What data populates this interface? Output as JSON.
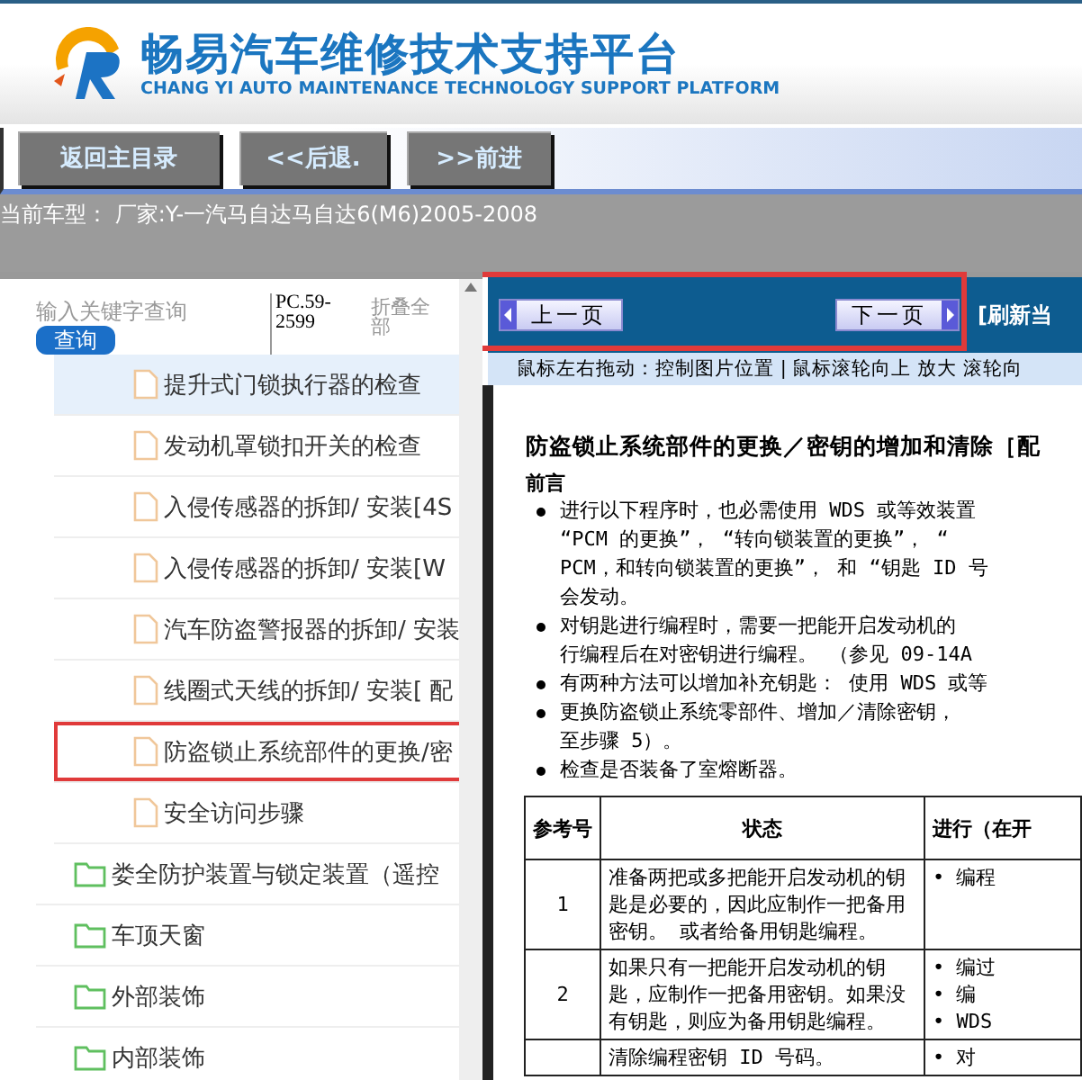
{
  "header": {
    "title": "畅易汽车维修技术支持平台",
    "subtitle": "CHANG YI AUTO MAINTENANCE TECHNOLOGY SUPPORT PLATFORM"
  },
  "nav_buttons": [
    "返回主目录",
    "<<后退.",
    ">>前进"
  ],
  "current_model": "当前车型： 厂家:Y-一汽马自达马自达6(M6)2005-2008",
  "sidebar": {
    "search": {
      "placeholder": "输入关键字查询",
      "button": "查询"
    },
    "code": "PC.59-2599",
    "collapse": "折叠全部",
    "tree_items": [
      {
        "label": "提升式门锁执行器的检查",
        "kind": "file",
        "selected": true,
        "highlighted": false
      },
      {
        "label": "发动机罩锁扣开关的检查",
        "kind": "file",
        "selected": false,
        "highlighted": false
      },
      {
        "label": "入侵传感器的拆卸/ 安装[4S",
        "kind": "file",
        "selected": false,
        "highlighted": false
      },
      {
        "label": "入侵传感器的拆卸/ 安装[W",
        "kind": "file",
        "selected": false,
        "highlighted": false
      },
      {
        "label": "汽车防盗警报器的拆卸/ 安装",
        "kind": "file",
        "selected": false,
        "highlighted": false
      },
      {
        "label": "线圈式天线的拆卸/ 安装[ 配",
        "kind": "file",
        "selected": false,
        "highlighted": false
      },
      {
        "label": "防盗锁止系统部件的更换/密",
        "kind": "file",
        "selected": false,
        "highlighted": true
      },
      {
        "label": "安全访问步骤",
        "kind": "file",
        "selected": false,
        "highlighted": false
      },
      {
        "label": "娄全防护装置与锁定装置（遥控",
        "kind": "folder",
        "selected": false,
        "highlighted": false
      },
      {
        "label": "车顶天窗",
        "kind": "folder",
        "selected": false,
        "highlighted": false
      },
      {
        "label": "外部装饰",
        "kind": "folder",
        "selected": false,
        "highlighted": false
      },
      {
        "label": "内部装饰",
        "kind": "folder",
        "selected": false,
        "highlighted": false
      }
    ]
  },
  "viewer": {
    "prev": "上一页",
    "next": "下一页",
    "refresh": "[刷新当",
    "highlighted": true,
    "hint": "鼠标左右拖动：控制图片位置 | 鼠标滚轮向上 放大  滚轮向",
    "document": {
      "title": "防盗锁止系统部件的更换／密钥的增加和清除［配",
      "section": "前言",
      "bullets": [
        [
          "进行以下程序时，也必需使用 WDS 或等效装置",
          "“PCM 的更换”， “转向锁装置的更换”， “",
          "PCM，和转向锁装置的更换”， 和 “钥匙 ID 号",
          "会发动。"
        ],
        [
          "对钥匙进行编程时，需要一把能开启发动机的",
          "行编程后在对密钥进行编程。 （参见 09-14A"
        ],
        [
          "有两种方法可以增加补充钥匙： 使用 WDS 或等"
        ],
        [
          "更换防盗锁止系统零部件、增加／清除密钥，",
          "至步骤 5）。"
        ],
        [
          "检查是否装备了室熔断器。"
        ]
      ],
      "table": {
        "columns": [
          "参考号",
          "状态",
          "进行（在开"
        ],
        "rows": [
          [
            "1",
            "准备两把或多把能开启发动机的钥匙是必要的，因此应制作一把备用密钥。 或者给备用钥匙编程。",
            "• 编程"
          ],
          [
            "2",
            "如果只有一把能开启发动机的钥匙，应制作一把备用密钥。如果没有钥匙，则应为备用钥匙编程。",
            "• 编过\n• 编\n• WDS"
          ],
          [
            "",
            "清除编程密钥 ID 号码。",
            "• 对"
          ]
        ]
      }
    }
  }
}
